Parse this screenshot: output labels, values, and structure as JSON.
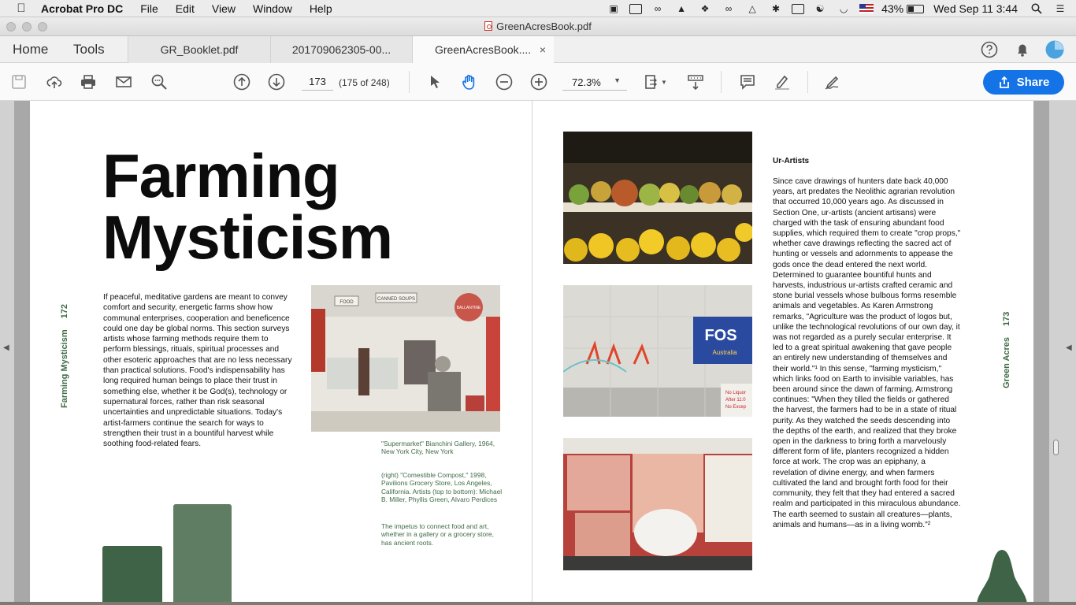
{
  "menubar": {
    "app_name": "Acrobat Pro DC",
    "menus": [
      "File",
      "Edit",
      "View",
      "Window",
      "Help"
    ],
    "battery_percent": "43%",
    "battery_level": 0.43,
    "clock": "Wed Sep 11  3:44"
  },
  "window": {
    "title": "GreenAcresBook.pdf"
  },
  "tabs": {
    "home": "Home",
    "tools": "Tools",
    "documents": [
      {
        "label": "GR_Booklet.pdf",
        "active": false
      },
      {
        "label": "201709062305-00...",
        "active": false
      },
      {
        "label": "GreenAcresBook....",
        "active": true
      }
    ],
    "close_glyph": "×"
  },
  "toolbar": {
    "page_number": "173",
    "page_count": "(175 of 248)",
    "zoom": "72.3%",
    "share_label": "Share"
  },
  "left_page": {
    "title": "Farming\nMysticism",
    "spine_label": "Farming Mysticism",
    "spine_page": "172",
    "body": "If peaceful, meditative gardens are meant to convey comfort and security, energetic farms show how communal enterprises, cooperation and beneficence could one day be global norms. This section surveys artists whose farming methods require them to perform blessings, rituals, spiritual processes and other esoteric approaches that are no less necessary than practical solutions. Food's indispensability has long required human beings to place their trust in something else, whether it be God(s), technology or supernatural forces, rather than risk seasonal uncertainties and unpredictable situations. Today's artist-farmers continue the search for ways to strengthen their trust in a bountiful harvest while soothing food-related fears.",
    "caption_1": "\"Supermarket\" Bianchini Gallery, 1964, New York City, New York",
    "caption_2": "(right) \"Comestible Compost,\" 1998, Pavilions Grocery Store, Los Angeles, California. Artists (top to bottom): Michael B. Miller, Phyllis Green, Alvaro Perdices",
    "caption_3": "The impetus to connect food and art, whether in a gallery or a grocery store, has ancient roots."
  },
  "right_page": {
    "heading": "Ur-Artists",
    "spine_label": "Green Acres",
    "spine_page": "173",
    "body": "Since cave drawings of hunters date back 40,000 years, art predates the Neolithic agrarian revolution that occurred 10,000 years ago. As discussed in Section One, ur-artists (ancient artisans) were charged with the task of ensuring abundant food supplies, which required them to create \"crop props,\" whether cave drawings reflecting the sacred act of hunting or vessels and adornments to appease the gods once the dead entered the next world. Determined to guarantee bountiful hunts and harvests, industrious ur-artists crafted ceramic and stone burial vessels whose bulbous forms resemble animals and vegetables. As Karen Armstrong remarks, \"Agriculture was the product of logos but, unlike the technological revolutions of our own day, it was not regarded as a purely secular enterprise. It led to a great spiritual awakening that gave people an entirely new understanding of themselves and their world.\"¹ In this sense, \"farming mysticism,\" which links food on Earth to invisible variables, has been around since the dawn of farming. Armstrong continues: \"When they tilled the fields or gathered the harvest, the farmers had to be in a state of ritual purity. As they watched the seeds descending into the depths of the earth, and realized that they broke open in the darkness to bring forth a marvelously different form of life, planters recognized a hidden force at work. The crop was an epiphany, a revelation of divine energy, and when farmers cultivated the land and brought forth food for their community, they felt that they had entered a sacred realm and participated in this miraculous abundance. The earth seemed to sustain all creatures—plants, animals and humans—as in a living womb.\"²"
  },
  "photo_text": {
    "supermarket_signs": [
      "FOOD",
      "CANNED SOUPS",
      "BALLANTINE"
    ],
    "sign_fos": "FOS",
    "sign_australia": "Australia",
    "notice_lines": [
      "No Liquor",
      "After 11:0",
      "No Excep"
    ]
  },
  "colors": {
    "accent_green": "#3e6346",
    "share_blue": "#1473e6"
  }
}
